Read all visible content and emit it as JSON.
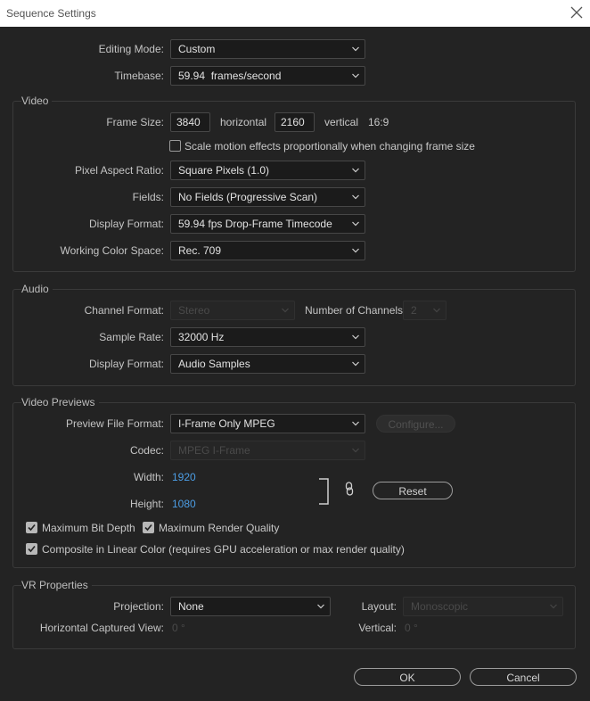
{
  "window": {
    "title": "Sequence Settings"
  },
  "general": {
    "editing_mode_label": "Editing Mode:",
    "editing_mode_value": "Custom",
    "timebase_label": "Timebase:",
    "timebase_value": "59.94  frames/second"
  },
  "video": {
    "section_title": "Video",
    "frame_size_label": "Frame Size:",
    "width_value": "3840",
    "horizontal_label": "horizontal",
    "height_value": "2160",
    "vertical_label": "vertical",
    "aspect_label": "16:9",
    "scale_motion_label": "Scale motion effects proportionally when changing frame size",
    "scale_motion_checked": false,
    "pixel_aspect_label": "Pixel Aspect Ratio:",
    "pixel_aspect_value": "Square Pixels (1.0)",
    "fields_label": "Fields:",
    "fields_value": "No Fields (Progressive Scan)",
    "display_format_label": "Display Format:",
    "display_format_value": "59.94 fps Drop-Frame Timecode",
    "color_space_label": "Working Color Space:",
    "color_space_value": "Rec. 709"
  },
  "audio": {
    "section_title": "Audio",
    "channel_format_label": "Channel Format:",
    "channel_format_value": "Stereo",
    "num_channels_label": "Number of Channels:",
    "num_channels_value": "2",
    "sample_rate_label": "Sample Rate:",
    "sample_rate_value": "32000 Hz",
    "display_format_label": "Display Format:",
    "display_format_value": "Audio Samples"
  },
  "previews": {
    "section_title": "Video Previews",
    "file_format_label": "Preview File Format:",
    "file_format_value": "I-Frame Only MPEG",
    "configure_label": "Configure...",
    "codec_label": "Codec:",
    "codec_value": "MPEG I-Frame",
    "width_label": "Width:",
    "width_value": "1920",
    "height_label": "Height:",
    "height_value": "1080",
    "reset_label": "Reset",
    "max_bit_depth_label": "Maximum Bit Depth",
    "max_render_quality_label": "Maximum Render Quality",
    "linear_color_label": "Composite in Linear Color (requires GPU acceleration or max render quality)"
  },
  "vr": {
    "section_title": "VR Properties",
    "projection_label": "Projection:",
    "projection_value": "None",
    "layout_label": "Layout:",
    "layout_value": "Monoscopic",
    "h_view_label": "Horizontal Captured View:",
    "h_view_value": "0 °",
    "vertical_label": "Vertical:",
    "vertical_value": "0 °"
  },
  "footer": {
    "ok_label": "OK",
    "cancel_label": "Cancel"
  }
}
